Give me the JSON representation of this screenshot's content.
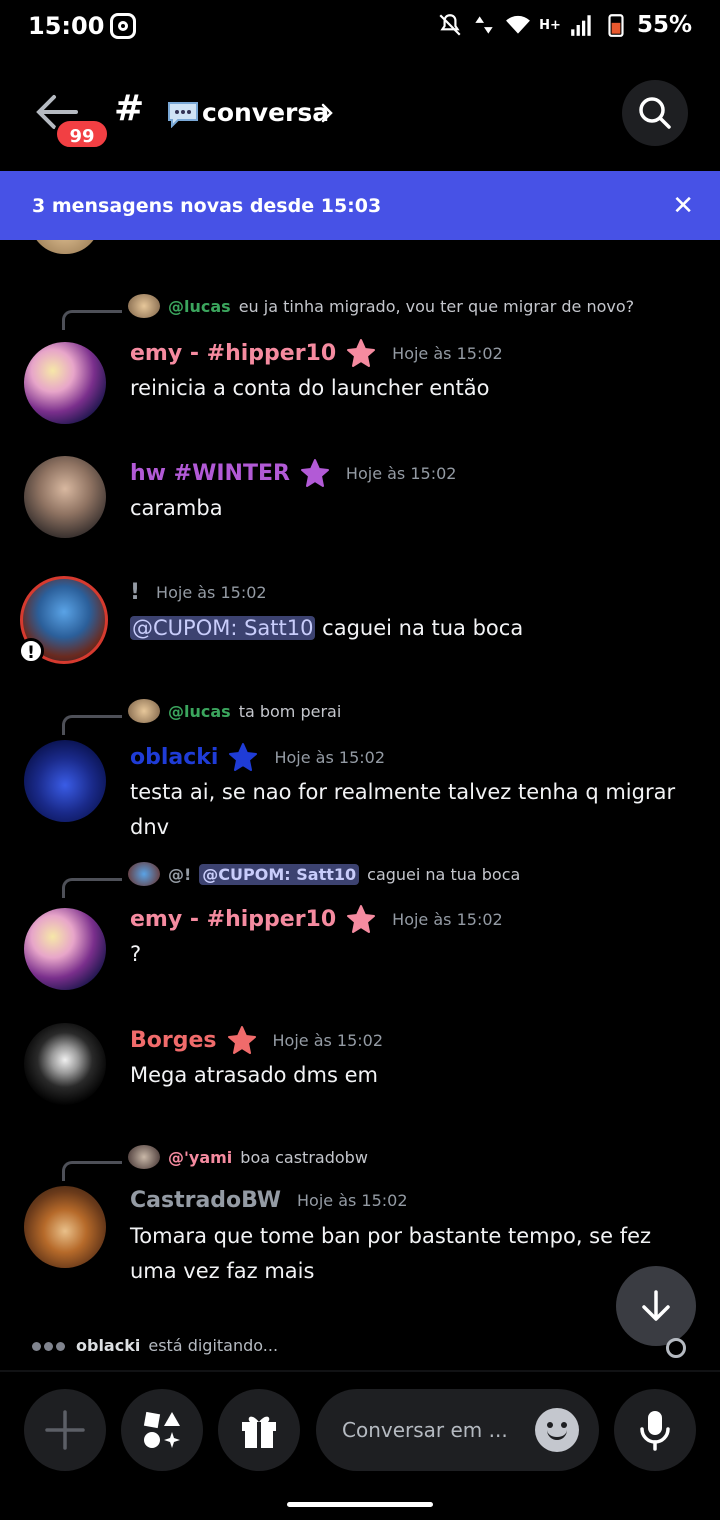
{
  "status_bar": {
    "time": "15:00",
    "battery": "55%",
    "network_label": "H+"
  },
  "header": {
    "back_badge": "99",
    "channel_emoji": "speech-balloon-icon",
    "channel_name": "conversa"
  },
  "banner": {
    "text": "3 mensagens novas desde 15:03",
    "close": "✕"
  },
  "messages": [
    {
      "reply": {
        "name": "@lucas",
        "text": "eu ja tinha migrado, vou ter que migrar de novo?",
        "name_color": "#3ba55d"
      },
      "author": "emy - #hipper10",
      "author_color": "#f58ba0",
      "role_color": "#f58ba0",
      "time": "Hoje às 15:02",
      "body": "reinicia a conta do launcher então"
    },
    {
      "author": "hw #WINTER",
      "author_color": "#b25ad6",
      "role_color": "#b25ad6",
      "time": "Hoje às 15:02",
      "body": "caramba"
    },
    {
      "author": "!",
      "author_color": "#949ba4",
      "time": "Hoje às 15:02",
      "mention": "@CUPOM: Satt10",
      "body": "caguei na tua boca",
      "avatar_badge": "!"
    },
    {
      "reply": {
        "name": "@lucas",
        "text": "ta bom perai",
        "name_color": "#3ba55d"
      },
      "author": "oblacki",
      "author_color": "#1f3cd6",
      "role_color": "#1f3cd6",
      "time": "Hoje às 15:02",
      "body": "testa ai, se nao for realmente talvez tenha q migrar dnv"
    },
    {
      "reply": {
        "name": "@!",
        "mention": "@CUPOM: Satt10",
        "text": "caguei na tua boca",
        "name_color": "#949ba4"
      },
      "author": "emy - #hipper10",
      "author_color": "#f58ba0",
      "role_color": "#f58ba0",
      "time": "Hoje às 15:02",
      "body": "?"
    },
    {
      "author": "Borges",
      "author_color": "#f06b6b",
      "role_color": "#f06b6b",
      "time": "Hoje às 15:02",
      "body": "Mega atrasado dms em"
    },
    {
      "reply": {
        "name": "@'yami",
        "text": "boa castradobw",
        "name_color": "#f58ba0"
      },
      "author": "CastradoBW",
      "author_color": "#949ba4",
      "time": "Hoje às 15:02",
      "body": "Tomara que tome ban por bastante tempo, se fez uma vez faz mais"
    }
  ],
  "typing": {
    "name": "oblacki",
    "text": "está digitando..."
  },
  "composer": {
    "placeholder": "Conversar em ..."
  }
}
